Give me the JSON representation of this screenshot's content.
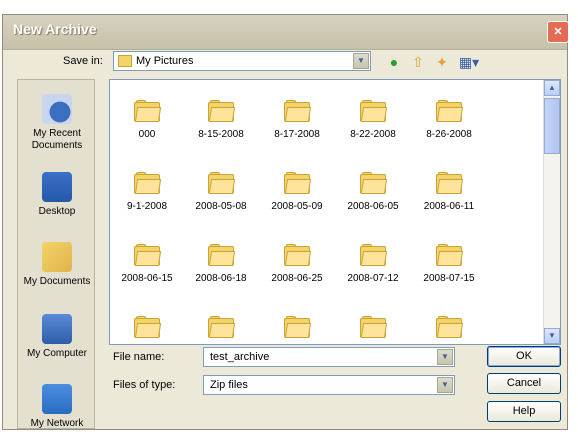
{
  "window": {
    "title": "New Archive",
    "close": "✕"
  },
  "toolbar": {
    "save_in_label": "Save in:",
    "location": "My Pictures",
    "icons": [
      "back-icon",
      "up-folder-icon",
      "new-folder-icon",
      "views-menu-icon"
    ]
  },
  "places": [
    {
      "label": "My Recent Documents",
      "icon": "recent-documents-icon"
    },
    {
      "label": "Desktop",
      "icon": "desktop-icon"
    },
    {
      "label": "My Documents",
      "icon": "my-documents-icon"
    },
    {
      "label": "My Computer",
      "icon": "my-computer-icon"
    },
    {
      "label": "My Network",
      "icon": "my-network-icon"
    }
  ],
  "folders": [
    [
      "000",
      "8-15-2008",
      "8-17-2008",
      "8-22-2008",
      "8-26-2008"
    ],
    [
      "9-1-2008",
      "2008-05-08",
      "2008-05-09",
      "2008-06-05",
      "2008-06-11"
    ],
    [
      "2008-06-15",
      "2008-06-18",
      "2008-06-25",
      "2008-07-12",
      "2008-07-15"
    ],
    [
      "",
      "",
      "",
      "",
      ""
    ]
  ],
  "form": {
    "file_name_label": "File name:",
    "file_name_value": "test_archive",
    "file_type_label": "Files of type:",
    "file_type_value": "Zip files"
  },
  "buttons": {
    "ok": "OK",
    "cancel": "Cancel",
    "help": "Help"
  },
  "colors": {
    "folder": "#f3d36a",
    "title_text": "#ffffff",
    "dialog_bg": "#ece9d8",
    "close": "#e46c55"
  }
}
